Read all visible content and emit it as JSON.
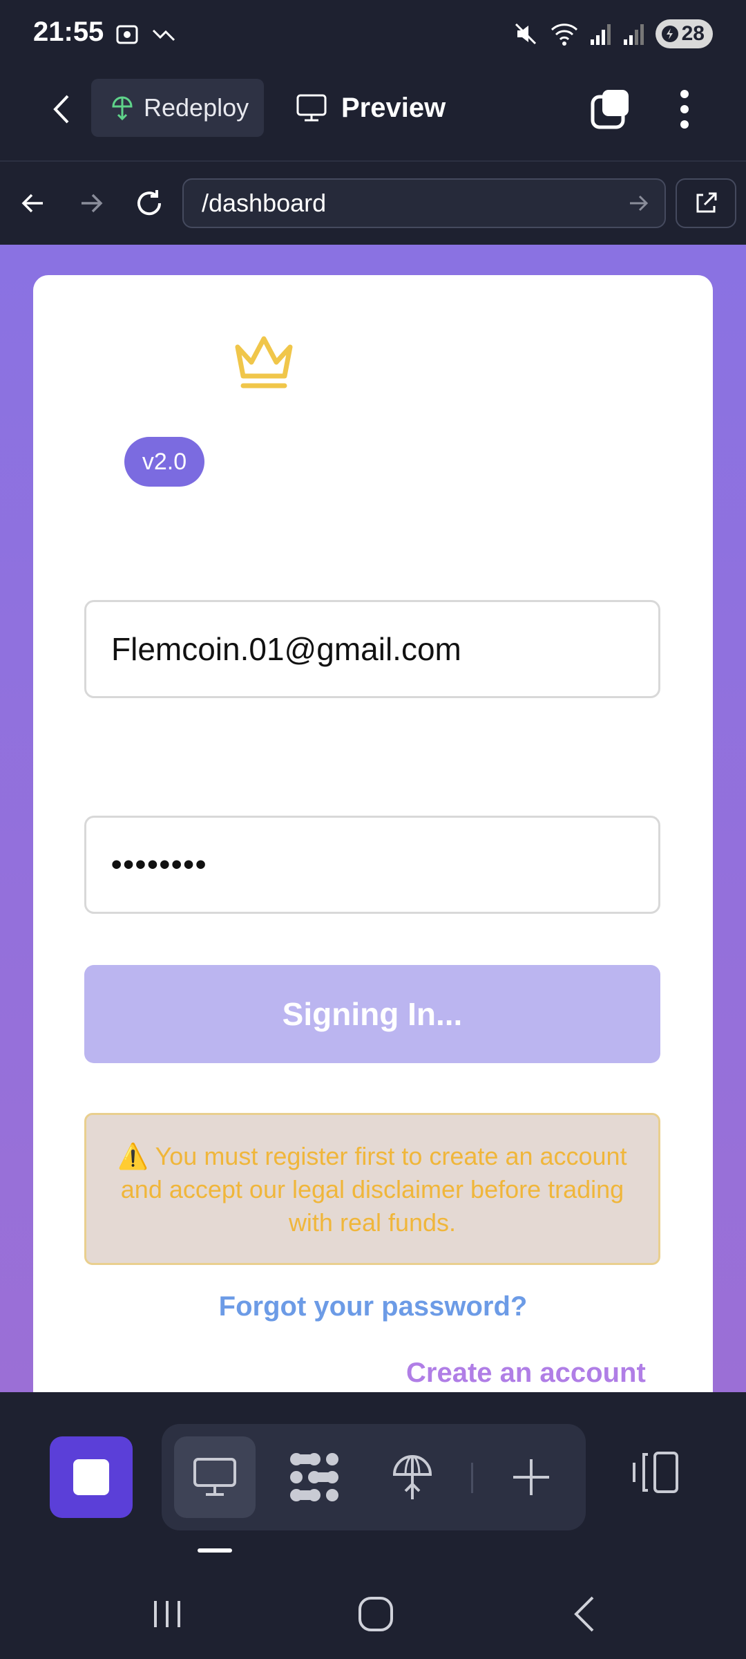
{
  "status_bar": {
    "time": "21:55",
    "battery": "28",
    "icons": [
      "screenshot-icon",
      "trend-icon",
      "mute-icon",
      "wifi-icon",
      "signal-icon",
      "signal-icon",
      "battery-icon"
    ]
  },
  "toolbar": {
    "redeploy_label": "Redeploy",
    "preview_label": "Preview"
  },
  "browser": {
    "url": "/dashboard"
  },
  "login": {
    "version": "v2.0",
    "email_value": "Flemcoin.01@gmail.com",
    "password_mask": "••••••••",
    "signin_label": "Signing In...",
    "warning_text": "⚠️ You must register first to create an account and accept our legal disclaimer before trading with real funds.",
    "forgot_label": "Forgot your password?",
    "create_label": "Create an account"
  },
  "colors": {
    "accent": "#5b3fd8",
    "badge": "#7b6be0",
    "signin_disabled": "#bbb5f0",
    "warning_text": "#f0b63a",
    "forgot_link": "#6c9be6",
    "create_link": "#b07ee6",
    "crown": "#f0c64a"
  }
}
